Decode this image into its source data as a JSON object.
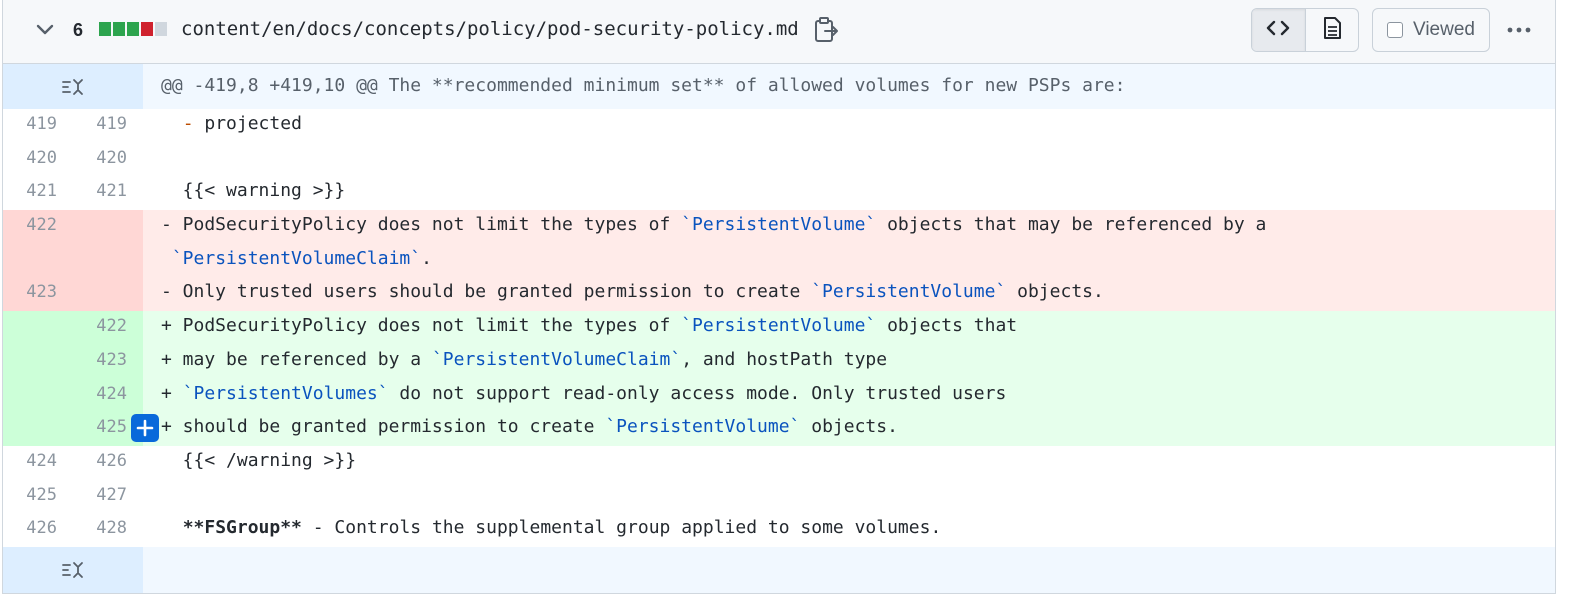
{
  "file": {
    "diff_count": "6",
    "diffstat": {
      "added": 3,
      "deleted": 1,
      "neutral": 1,
      "colors": {
        "added": "#2da44e",
        "deleted": "#cf222e",
        "neutral": "#d0d7de"
      }
    },
    "path": "content/en/docs/concepts/policy/pod-security-policy.md",
    "viewed_label": "Viewed"
  },
  "icons": {
    "collapse": "chevron-down-icon",
    "copy": "copy-path-icon",
    "code_view": "code-icon",
    "rich_view": "file-icon",
    "more": "kebab-horizontal-icon",
    "expand": "unfold-icon",
    "add_comment": "plus-icon"
  },
  "hunk_header": "@@ -419,8 +419,10 @@ The **recommended minimum set** of allowed volumes for new PSPs are:",
  "lines": [
    {
      "old": "419",
      "new": "419",
      "type": "ctx",
      "parts": [
        [
          "  ",
          ""
        ],
        [
          "-",
          "minus-orange"
        ],
        [
          " projected",
          ""
        ]
      ]
    },
    {
      "old": "420",
      "new": "420",
      "type": "ctx",
      "parts": []
    },
    {
      "old": "421",
      "new": "421",
      "type": "ctx",
      "parts": [
        [
          "  {{< warning >}}",
          ""
        ]
      ]
    },
    {
      "old": "422",
      "new": "",
      "type": "del",
      "parts": [
        [
          "- PodSecurityPolicy does not limit the types of ",
          ""
        ],
        [
          "`PersistentVolume`",
          "tick"
        ],
        [
          " objects that may be referenced by a",
          ""
        ]
      ]
    },
    {
      "old": "",
      "new": "",
      "type": "del",
      "parts": [
        [
          " ",
          ""
        ],
        [
          "`PersistentVolumeClaim`",
          "tick"
        ],
        [
          ".",
          ""
        ]
      ]
    },
    {
      "old": "423",
      "new": "",
      "type": "del",
      "parts": [
        [
          "- Only trusted users should be granted permission to create ",
          ""
        ],
        [
          "`PersistentVolume`",
          "tick"
        ],
        [
          " objects.",
          ""
        ]
      ]
    },
    {
      "old": "",
      "new": "422",
      "type": "add",
      "parts": [
        [
          "+ PodSecurityPolicy does not limit the types of ",
          ""
        ],
        [
          "`PersistentVolume`",
          "tick"
        ],
        [
          " objects that",
          ""
        ]
      ]
    },
    {
      "old": "",
      "new": "423",
      "type": "add",
      "parts": [
        [
          "+ may be referenced by a ",
          ""
        ],
        [
          "`PersistentVolumeClaim`",
          "tick"
        ],
        [
          ", and hostPath type",
          ""
        ]
      ]
    },
    {
      "old": "",
      "new": "424",
      "type": "add",
      "parts": [
        [
          "+ ",
          ""
        ],
        [
          "`PersistentVolumes`",
          "tick"
        ],
        [
          " do not support read-only access mode. Only trusted users",
          ""
        ]
      ]
    },
    {
      "old": "",
      "new": "425",
      "type": "add",
      "comment": true,
      "parts": [
        [
          "+ should be granted permission to create ",
          ""
        ],
        [
          "`PersistentVolume`",
          "tick"
        ],
        [
          " objects.",
          ""
        ]
      ]
    },
    {
      "old": "424",
      "new": "426",
      "type": "ctx",
      "parts": [
        [
          "  {{< /warning >}}",
          ""
        ]
      ]
    },
    {
      "old": "425",
      "new": "427",
      "type": "ctx",
      "parts": []
    },
    {
      "old": "426",
      "new": "428",
      "type": "ctx",
      "parts": [
        [
          "  ",
          ""
        ],
        [
          "**FSGroup**",
          "b"
        ],
        [
          " - Controls the supplemental group applied to some volumes.",
          ""
        ]
      ]
    }
  ]
}
